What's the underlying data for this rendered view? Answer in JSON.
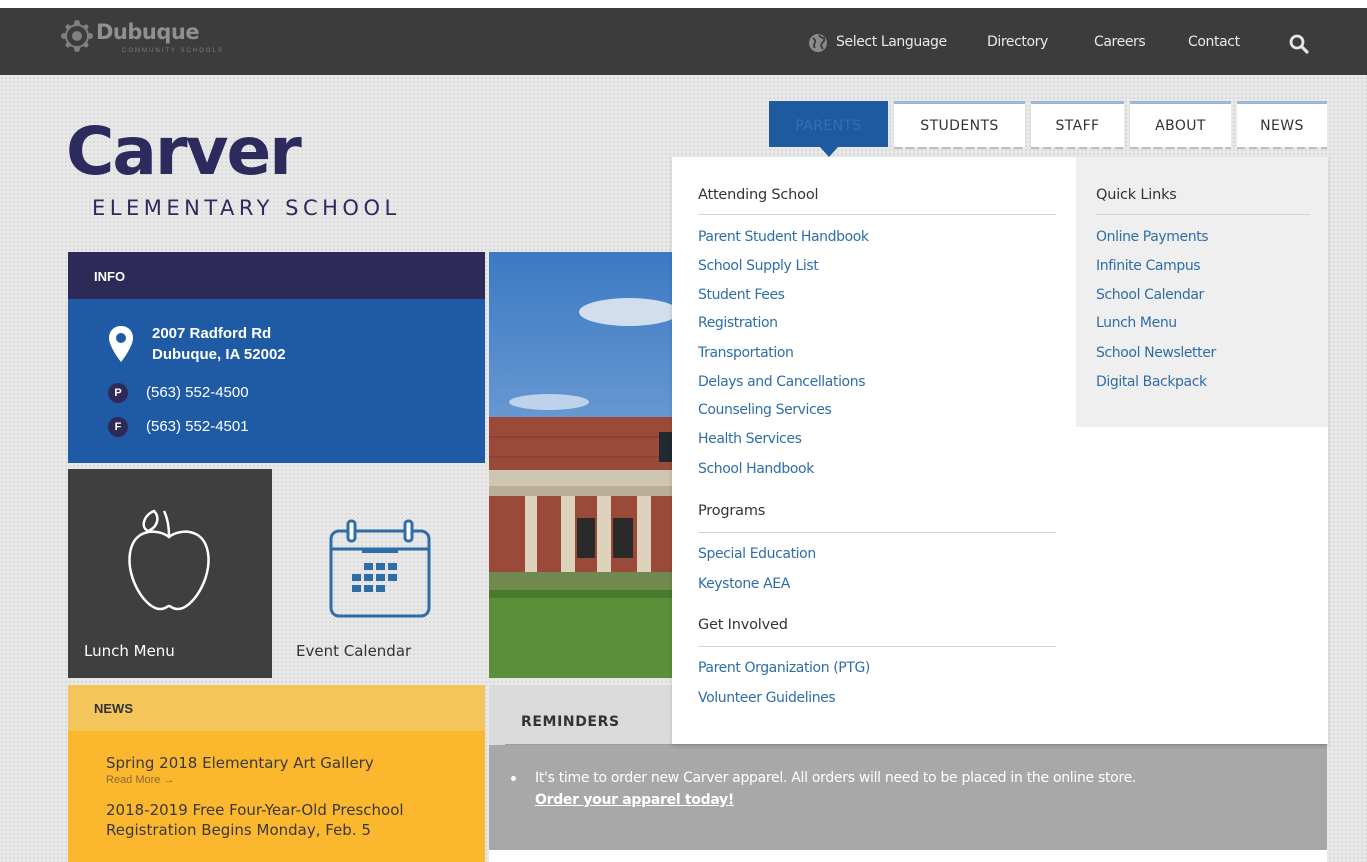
{
  "topbar": {
    "district_name": "Dubuque",
    "district_sub": "COMMUNITY SCHOOLS",
    "nav": [
      "Select Language",
      "Directory",
      "Careers",
      "Contact"
    ]
  },
  "school": {
    "name": "Carver",
    "subtitle": "ELEMENTARY SCHOOL"
  },
  "tabs": [
    {
      "label": "PARENTS",
      "active": true
    },
    {
      "label": "STUDENTS",
      "active": false
    },
    {
      "label": "STAFF",
      "active": false
    },
    {
      "label": "ABOUT",
      "active": false
    },
    {
      "label": "NEWS",
      "active": false
    }
  ],
  "info": {
    "heading": "INFO",
    "address_line1": "2007 Radford Rd",
    "address_line2": "Dubuque, IA 52002",
    "phone_badge": "P",
    "phone": "(563) 552-4500",
    "fax_badge": "F",
    "fax": "(563) 552-4501"
  },
  "tiles": {
    "lunch": "Lunch Menu",
    "event": "Event Calendar"
  },
  "news": {
    "heading": "NEWS",
    "items": [
      {
        "title": "Spring 2018 Elementary Art Gallery",
        "more": "Read More →"
      },
      {
        "title": "2018-2019 Free Four-Year-Old Preschool Registration Begins Monday, Feb. 5",
        "more": ""
      }
    ]
  },
  "reminders": {
    "heading": "REMINDERS",
    "text": "It's time to order new Carver apparel.  All orders will need to be placed in the online store.",
    "link": "Order your apparel today!"
  },
  "dropdown": {
    "attending": {
      "heading": "Attending School",
      "links": [
        "Parent Student Handbook",
        "School Supply List",
        "Student Fees",
        "Registration",
        "Transportation",
        "Delays and Cancellations",
        "Counseling Services",
        "Health Services",
        "School Handbook"
      ]
    },
    "programs": {
      "heading": "Programs",
      "links": [
        "Special Education",
        "Keystone AEA"
      ]
    },
    "involved": {
      "heading": "Get Involved",
      "links": [
        "Parent Organization (PTG)",
        "Volunteer Guidelines"
      ]
    },
    "quick": {
      "heading": "Quick Links",
      "links": [
        "Online Payments",
        "Infinite Campus",
        "School Calendar",
        "Lunch Menu",
        "School Newsletter",
        "Digital Backpack"
      ]
    }
  },
  "colors": {
    "navy": "#2d2a57",
    "blue": "#1f5aa5",
    "link": "#2e6ea8",
    "gold": "#fbb72e",
    "topbar": "#3c3c3c"
  }
}
